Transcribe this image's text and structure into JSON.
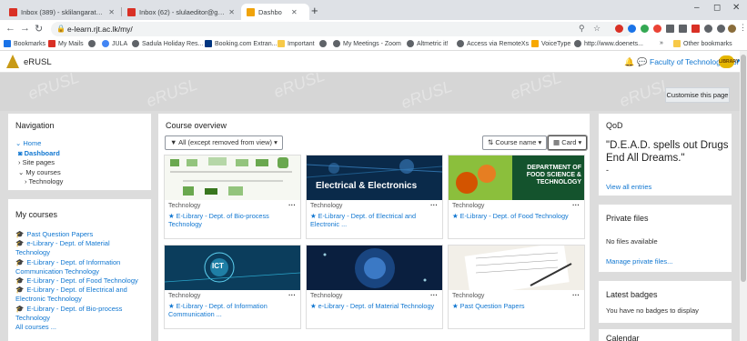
{
  "browser": {
    "tabs": [
      {
        "label": "Inbox (389) - sklilangarathne@g",
        "color": "#d93025"
      },
      {
        "label": "Inbox (62) - slulaeditor@gmail.c",
        "color": "#d93025"
      },
      {
        "label": "Dashboard",
        "color": "#f0a30a"
      }
    ],
    "url": "e-learn.rjt.ac.lk/my/",
    "bookmarks": [
      {
        "label": "Bookmarks",
        "color": "#1a73e8"
      },
      {
        "label": "My Mails",
        "color": "#d93025"
      },
      {
        "label": "",
        "color": "#5f6368"
      },
      {
        "label": "JULA",
        "color": "#4285f4"
      },
      {
        "label": "Sadula Holiday Res...",
        "color": "#5f6368"
      },
      {
        "label": "Booking.com Extran...",
        "color": "#003580"
      },
      {
        "label": "Important",
        "color": "#f7c948"
      },
      {
        "label": "",
        "color": "#5f6368"
      },
      {
        "label": "My Meetings - Zoom",
        "color": "#5f6368"
      },
      {
        "label": "Altmetric it!",
        "color": "#5f6368"
      },
      {
        "label": "Access via RemoteXs",
        "color": "#5f6368"
      },
      {
        "label": "VoiceType",
        "color": "#f7a800"
      },
      {
        "label": "http://www.doenets...",
        "color": "#5f6368"
      },
      {
        "label": "Other bookmarks",
        "color": "#f7c948"
      }
    ],
    "more_bookmarks": "»"
  },
  "site": {
    "name": "eRUSL",
    "user": "Faculty of Technology Library",
    "avatar_text": "LIBRARY"
  },
  "customise_label": "Customise this page",
  "navigation": {
    "title": "Navigation",
    "items": [
      "Home",
      "Dashboard",
      "Site pages",
      "My courses",
      "Technology"
    ]
  },
  "my_courses": {
    "title": "My courses",
    "items": [
      "Past Question Papers",
      "e-Library - Dept. of Material Technology",
      "E-Library - Dept. of Information Communication Technology",
      "E-Library - Dept. of Food Technology",
      "E-Library - Dept. of Electrical and Electronic Technology",
      "E-Library - Dept. of Bio-process Technology"
    ],
    "all_courses": "All courses ..."
  },
  "course_overview": {
    "title": "Course overview",
    "filter": "All (except removed from view)",
    "sort": "Course name",
    "view": "Card",
    "courses": [
      {
        "category": "Technology",
        "name": "E-Library - Dept. of Bio-process Technology",
        "banner": "",
        "img": "bio"
      },
      {
        "category": "Technology",
        "name": "E-Library - Dept. of Electrical and Electronic ...",
        "banner": "Electrical & Electronics",
        "img": "elec"
      },
      {
        "category": "Technology",
        "name": "E-Library - Dept. of Food Technology",
        "banner": "DEPARTMENT OF FOOD SCIENCE & TECHNOLOGY",
        "img": "food"
      },
      {
        "category": "Technology",
        "name": "E-Library - Dept. of Information Communication ...",
        "banner": "ICT",
        "img": "ict"
      },
      {
        "category": "Technology",
        "name": "e-Library - Dept. of Material Technology",
        "banner": "",
        "img": "mat"
      },
      {
        "category": "Technology",
        "name": "Past Question Papers",
        "banner": "",
        "img": "paper"
      }
    ]
  },
  "qod": {
    "title": "QoD",
    "quote": "\"D.E.A.D. spells out Drugs End All Dreams.\"",
    "dash": "-",
    "view_all": "View all entries"
  },
  "private_files": {
    "title": "Private files",
    "empty": "No files available",
    "manage": "Manage private files..."
  },
  "latest_badges": {
    "title": "Latest badges",
    "empty": "You have no badges to display"
  },
  "calendar": {
    "title": "Calendar"
  }
}
